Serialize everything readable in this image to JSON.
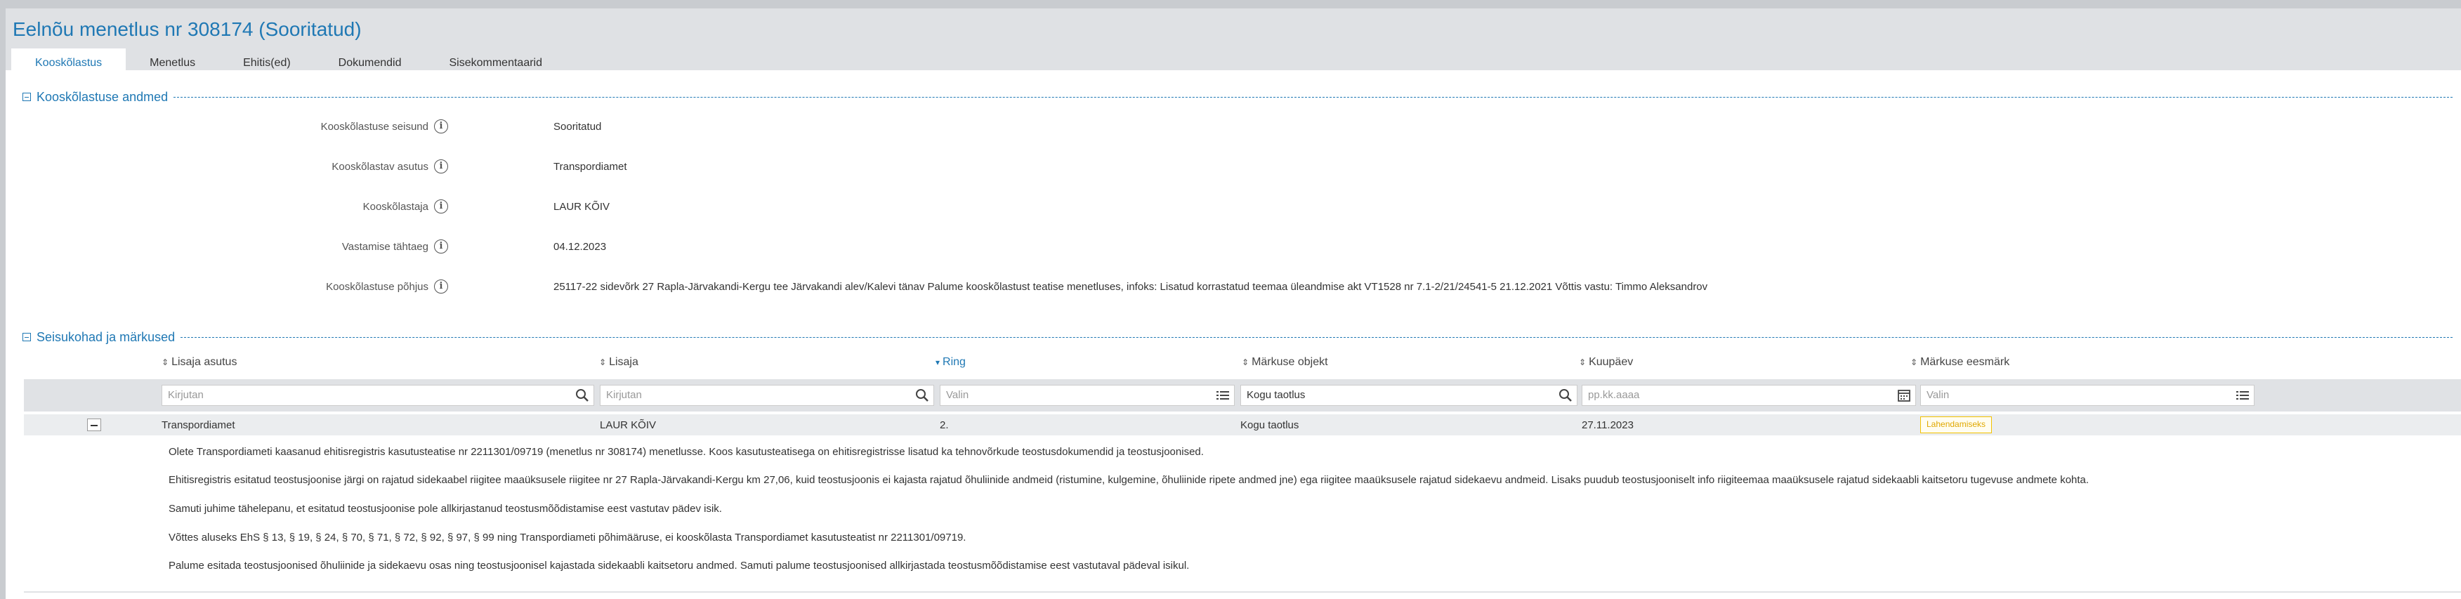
{
  "page": {
    "title": "Eelnõu menetlus nr 308174 (Sooritatud)"
  },
  "tabs": [
    {
      "label": "Kooskõlastus",
      "active": true
    },
    {
      "label": "Menetlus"
    },
    {
      "label": "Ehitis(ed)"
    },
    {
      "label": "Dokumendid"
    },
    {
      "label": "Sisekommentaarid"
    }
  ],
  "section1": {
    "title": "Kooskõlastuse andmed",
    "fields": [
      {
        "label": "Kooskõlastuse seisund",
        "value": "Sooritatud"
      },
      {
        "label": "Kooskõlastav asutus",
        "value": "Transpordiamet"
      },
      {
        "label": "Kooskõlastaja",
        "value": "LAUR KÕIV"
      },
      {
        "label": "Vastamise tähtaeg",
        "value": "04.12.2023"
      },
      {
        "label": "Kooskõlastuse põhjus",
        "value": "25117-22 sidevõrk 27 Rapla-Järvakandi-Kergu tee Järvakandi alev/Kalevi tänav Palume kooskõlastust teatise menetluses, infoks: Lisatud korrastatud teemaa üleandmise akt VT1528 nr 7.1-2/21/24541-5 21.12.2021 Võttis vastu: Timmo Aleksandrov"
      }
    ]
  },
  "section2": {
    "title": "Seisukohad ja märkused",
    "columns": [
      {
        "label": "Lisaja asutus",
        "sort": "none"
      },
      {
        "label": "Lisaja",
        "sort": "none"
      },
      {
        "label": "Ring",
        "sort": "desc"
      },
      {
        "label": "Märkuse objekt",
        "sort": "none"
      },
      {
        "label": "Kuupäev",
        "sort": "none"
      },
      {
        "label": "Märkuse eesmärk",
        "sort": "none"
      }
    ],
    "filters": [
      {
        "placeholder": "Kirjutan",
        "icon": "search-icon"
      },
      {
        "placeholder": "Kirjutan",
        "icon": "search-icon"
      },
      {
        "placeholder": "Valin",
        "icon": "list-icon"
      },
      {
        "value": "Kogu taotlus",
        "icon": "search-icon"
      },
      {
        "placeholder": "pp.kk.aaaa",
        "icon": "calendar-icon"
      },
      {
        "placeholder": "Valin",
        "icon": "list-icon"
      }
    ],
    "row": {
      "asutus": "Transpordiamet",
      "lisaja": "LAUR KÕIV",
      "ring": "2.",
      "objekt": "Kogu taotlus",
      "kuupaev": "27.11.2023",
      "eesmark": "Lahendamiseks"
    },
    "details": [
      "Olete Transpordiameti kaasanud ehitisregistris kasutusteatise nr 2211301/09719 (menetlus nr 308174) menetlusse. Koos kasutusteatisega on ehitisregistrisse lisatud ka tehnovõrkude teostusdokumendid ja teostusjoonised.",
      "Ehitisregistris esitatud teostusjoonise järgi on rajatud sidekaabel riigitee maaüksusele riigitee nr 27 Rapla-Järvakandi-Kergu km 27,06, kuid teostusjoonis ei kajasta rajatud õhuliinide andmeid (ristumine, kulgemine, õhuliinide ripete andmed jne) ega riigitee maaüksusele rajatud sidekaevu andmeid. Lisaks puudub teostusjooniselt info riigiteemaa maaüksusele rajatud sidekaabli kaitsetoru tugevuse andmete kohta.",
      "Samuti juhime tähelepanu, et esitatud teostusjoonise pole allkirjastanud teostusmõõdistamise eest vastutav pädev isik.",
      "Võttes aluseks EhS § 13, § 19, § 24, § 70, § 71, § 72, § 92, § 97, § 99 ning Transpordiameti põhimääruse, ei kooskõlasta Transpordiamet kasutusteatist nr 2211301/09719.",
      "Palume esitada teostusjoonised õhuliinide ja sidekaevu osas ning teostusjoonisel kajastada sidekaabli kaitsetoru andmed. Samuti palume teostusjoonised allkirjastada teostusmõõdistamise eest vastutaval pädeval isikul."
    ]
  },
  "colors": {
    "accent": "#1f78b4",
    "badge_border": "#f2c200"
  }
}
